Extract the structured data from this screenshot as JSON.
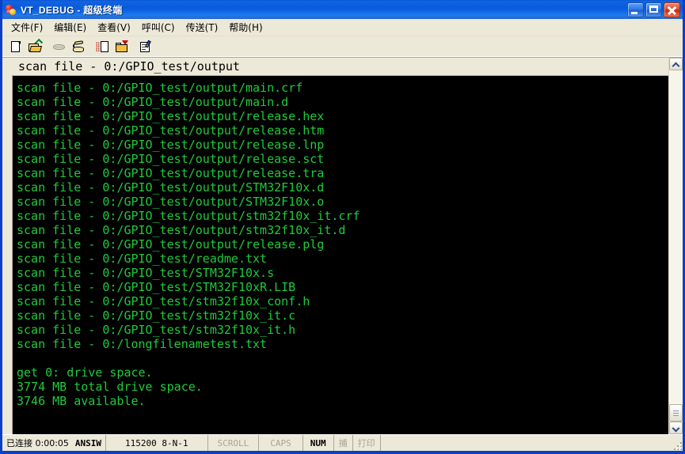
{
  "window": {
    "title": "VT_DEBUG - 超级终端",
    "icon": "hyperterminal-icon",
    "minimize_label": "",
    "maximize_label": "",
    "close_label": ""
  },
  "menu": {
    "items": [
      {
        "label": "文件(F)",
        "name": "menu-file"
      },
      {
        "label": "编辑(E)",
        "name": "menu-edit"
      },
      {
        "label": "查看(V)",
        "name": "menu-view"
      },
      {
        "label": "呼叫(C)",
        "name": "menu-call"
      },
      {
        "label": "传送(T)",
        "name": "menu-transfer"
      },
      {
        "label": "帮助(H)",
        "name": "menu-help"
      }
    ]
  },
  "toolbar": {
    "buttons": [
      {
        "icon": "new-document-icon",
        "name": "new-connection-button",
        "enabled": true
      },
      {
        "icon": "open-folder-icon",
        "name": "open-connection-button",
        "enabled": true
      },
      {
        "icon": "phone-disconnect-icon",
        "name": "disconnect-button",
        "enabled": false
      },
      {
        "icon": "phone-call-icon",
        "name": "call-button",
        "enabled": true
      },
      {
        "icon": "send-file-icon",
        "name": "send-file-button",
        "enabled": true
      },
      {
        "icon": "receive-file-icon",
        "name": "receive-file-button",
        "enabled": true
      },
      {
        "icon": "properties-icon",
        "name": "properties-button",
        "enabled": true
      }
    ]
  },
  "client": {
    "scrolled_line": "scan file - 0:/GPIO_test/output",
    "terminal_lines": [
      "scan file - 0:/GPIO_test/output/main.crf",
      "scan file - 0:/GPIO_test/output/main.d",
      "scan file - 0:/GPIO_test/output/release.hex",
      "scan file - 0:/GPIO_test/output/release.htm",
      "scan file - 0:/GPIO_test/output/release.lnp",
      "scan file - 0:/GPIO_test/output/release.sct",
      "scan file - 0:/GPIO_test/output/release.tra",
      "scan file - 0:/GPIO_test/output/STM32F10x.d",
      "scan file - 0:/GPIO_test/output/STM32F10x.o",
      "scan file - 0:/GPIO_test/output/stm32f10x_it.crf",
      "scan file - 0:/GPIO_test/output/stm32f10x_it.d",
      "scan file - 0:/GPIO_test/output/release.plg",
      "scan file - 0:/GPIO_test/readme.txt",
      "scan file - 0:/GPIO_test/STM32F10x.s",
      "scan file - 0:/GPIO_test/STM32F10xR.LIB",
      "scan file - 0:/GPIO_test/stm32f10x_conf.h",
      "scan file - 0:/GPIO_test/stm32f10x_it.c",
      "scan file - 0:/GPIO_test/stm32f10x_it.h",
      "scan file - 0:/longfilenametest.txt",
      "",
      "get 0: drive space.",
      "3774 MB total drive space.",
      "3746 MB available."
    ],
    "text_color": "#1ecb3c",
    "background_color": "#000000"
  },
  "scrollbar": {
    "up_arrow": "chevron-up-icon",
    "down_arrow": "chevron-down-icon",
    "thumb_position": "bottom"
  },
  "statusbar": {
    "connection": "已连接 0:00:05",
    "emulation": "ANSIW",
    "line_settings": "115200 8-N-1",
    "scroll": "SCROLL",
    "caps": "CAPS",
    "num": "NUM",
    "capture": "捕",
    "print": "打印"
  }
}
